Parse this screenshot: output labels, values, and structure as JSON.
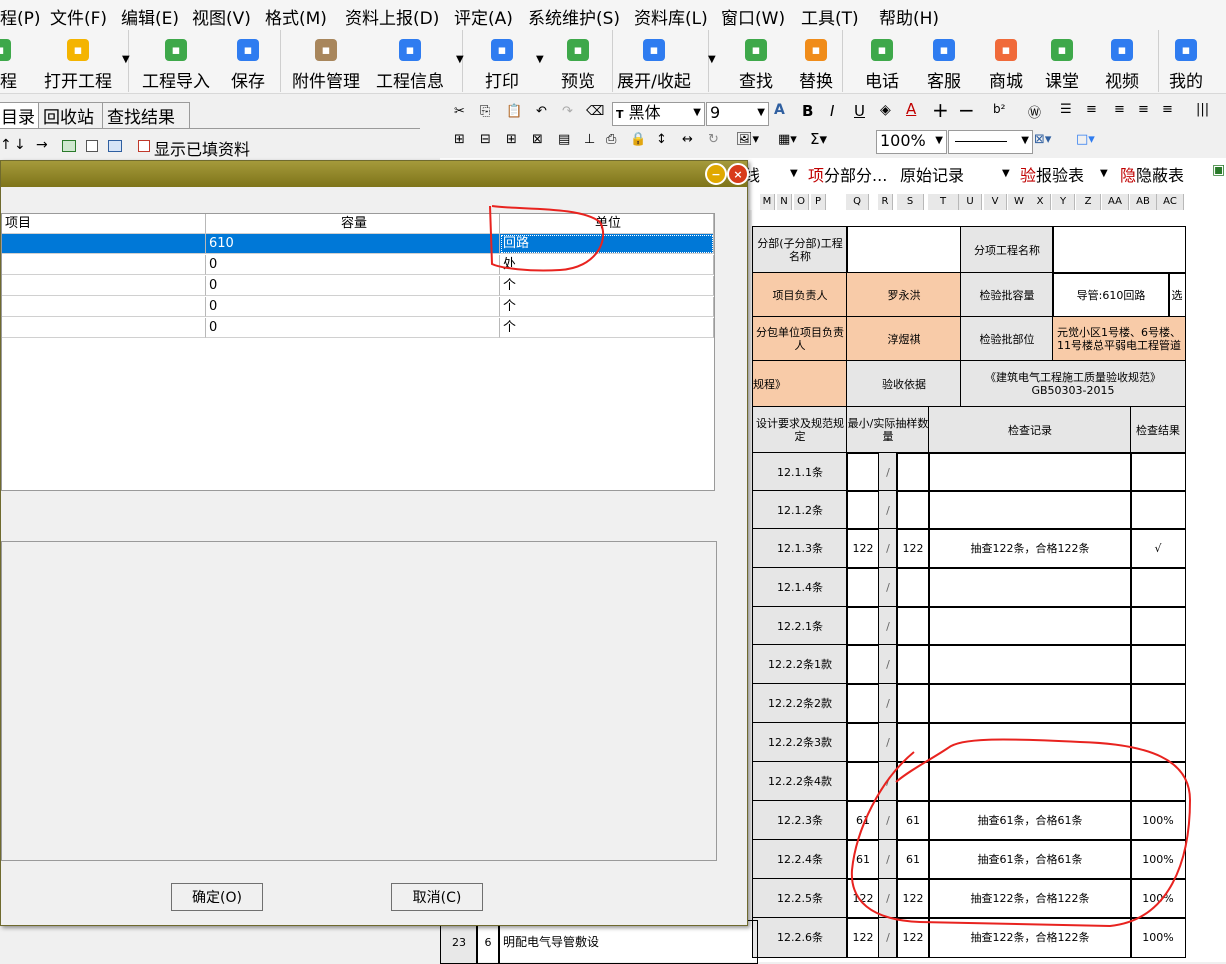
{
  "menu": [
    "程(P)",
    "文件(F)",
    "编辑(E)",
    "视图(V)",
    "格式(M)",
    "资料上报(D)",
    "评定(A)",
    "系统维护(S)",
    "资料库(L)",
    "窗口(W)",
    "工具(T)",
    "帮助(H)"
  ],
  "toolbar": [
    {
      "label": "工程",
      "icon": "new-project-icon",
      "color": "#3ea84a"
    },
    {
      "label": "打开工程",
      "icon": "open-folder-icon",
      "color": "#f4b400"
    },
    {
      "label": "工程导入",
      "icon": "import-icon",
      "color": "#3ea84a"
    },
    {
      "label": "保存",
      "icon": "save-icon",
      "color": "#2f7cf0"
    },
    {
      "label": "附件管理",
      "icon": "attachment-icon",
      "color": "#a8865c"
    },
    {
      "label": "工程信息",
      "icon": "info-icon",
      "color": "#2f7cf0"
    },
    {
      "label": "打印",
      "icon": "print-icon",
      "color": "#2f7cf0"
    },
    {
      "label": "预览",
      "icon": "preview-icon",
      "color": "#3ea84a"
    },
    {
      "label": "展开/收起",
      "icon": "expand-icon",
      "color": "#2f7cf0"
    },
    {
      "label": "查找",
      "icon": "find-icon",
      "color": "#3ea84a"
    },
    {
      "label": "替换",
      "icon": "replace-icon",
      "color": "#f08c1a"
    },
    {
      "label": "电话",
      "icon": "phone-icon",
      "color": "#3ea84a"
    },
    {
      "label": "客服",
      "icon": "headset-icon",
      "color": "#2f7cf0"
    },
    {
      "label": "商城",
      "icon": "shop-icon",
      "color": "#f06a3a"
    },
    {
      "label": "课堂",
      "icon": "class-icon",
      "color": "#3ea84a"
    },
    {
      "label": "视频",
      "icon": "video-icon",
      "color": "#2f7cf0"
    },
    {
      "label": "我的",
      "icon": "user-icon",
      "color": "#2f7cf0"
    }
  ],
  "left_tabs": [
    "目录",
    "回收站",
    "查找结果"
  ],
  "left_toolbar_label": "显示已填资料",
  "format": {
    "font": "黑体",
    "size": "9",
    "zoom": "100%"
  },
  "sheet_tabs": [
    "线",
    "分部分...",
    "原始记录",
    "报验表",
    "隐蔽表"
  ],
  "sheet_tab_prefix": [
    "项",
    "验",
    "隐"
  ],
  "col_headers": [
    "M",
    "N",
    "O",
    "P",
    "Q",
    "R",
    "S",
    "T",
    "U",
    "V",
    "W",
    "X",
    "Y",
    "Z",
    "AA",
    "AB",
    "AC"
  ],
  "sheet": {
    "fenbu_label": "分部(子分部)工程名称",
    "fenxiang_label": "分项工程名称",
    "xiangmu_fuze_label": "项目负责人",
    "xiangmu_fuze": "罗永洪",
    "jianyan_rongliang_label": "检验批容量",
    "jianyan_rongliang": "导管:610回路",
    "xuan": "选",
    "fenbao_label": "分包单位项目负责人",
    "fenbao": "淳煜祺",
    "jianyan_buwei_label": "检验批部位",
    "jianyan_buwei": "元觉小区1号楼、6号楼、11号楼总平弱电工程管道",
    "guicheng": "规程》",
    "yanshou_label": "验收依据",
    "yanshou": "《建筑电气工程施工质量验收规范》GB50303-2015",
    "col_design": "设计要求及规范规定",
    "col_sample": "最小/实际抽样数量",
    "col_record": "检查记录",
    "col_result": "检查结果",
    "rows": [
      {
        "clause": "12.1.1条",
        "min": "",
        "actual": "",
        "record": "",
        "result": ""
      },
      {
        "clause": "12.1.2条",
        "min": "",
        "actual": "",
        "record": "",
        "result": ""
      },
      {
        "clause": "12.1.3条",
        "min": "122",
        "actual": "122",
        "record": "抽查122条，合格122条",
        "result": "√"
      },
      {
        "clause": "12.1.4条",
        "min": "",
        "actual": "",
        "record": "",
        "result": ""
      },
      {
        "clause": "12.2.1条",
        "min": "",
        "actual": "",
        "record": "",
        "result": ""
      },
      {
        "clause": "12.2.2条1款",
        "min": "",
        "actual": "",
        "record": "",
        "result": ""
      },
      {
        "clause": "12.2.2条2款",
        "min": "",
        "actual": "",
        "record": "",
        "result": ""
      },
      {
        "clause": "12.2.2条3款",
        "min": "",
        "actual": "",
        "record": "",
        "result": ""
      },
      {
        "clause": "12.2.2条4款",
        "min": "",
        "actual": "",
        "record": "",
        "result": ""
      },
      {
        "clause": "12.2.3条",
        "min": "61",
        "actual": "61",
        "record": "抽查61条，合格61条",
        "result": "100%"
      },
      {
        "clause": "12.2.4条",
        "min": "61",
        "actual": "61",
        "record": "抽查61条，合格61条",
        "result": "100%"
      },
      {
        "clause": "12.2.5条",
        "min": "122",
        "actual": "122",
        "record": "抽查122条，合格122条",
        "result": "100%"
      },
      {
        "clause": "12.2.6条",
        "min": "122",
        "actual": "122",
        "record": "抽查122条，合格122条",
        "result": "100%"
      }
    ],
    "last_row_num": "23",
    "last_row_idx": "6",
    "last_row_text": "明配电气导管敷设",
    "slash": "/"
  },
  "dialog": {
    "headers": [
      "项目",
      "容量",
      "单位"
    ],
    "rows": [
      {
        "item": "",
        "capacity": "610",
        "unit": "回路"
      },
      {
        "item": "",
        "capacity": "0",
        "unit": "处"
      },
      {
        "item": "",
        "capacity": "0",
        "unit": "个"
      },
      {
        "item": "",
        "capacity": "0",
        "unit": "个"
      },
      {
        "item": "",
        "capacity": "0",
        "unit": "个"
      }
    ],
    "ok": "确定(O)",
    "cancel": "取消(C)"
  },
  "colors": {
    "selection": "#0078d7",
    "peach": "#f8cba8",
    "annotation": "#e8231f",
    "title_bar": "#8a7f22"
  }
}
